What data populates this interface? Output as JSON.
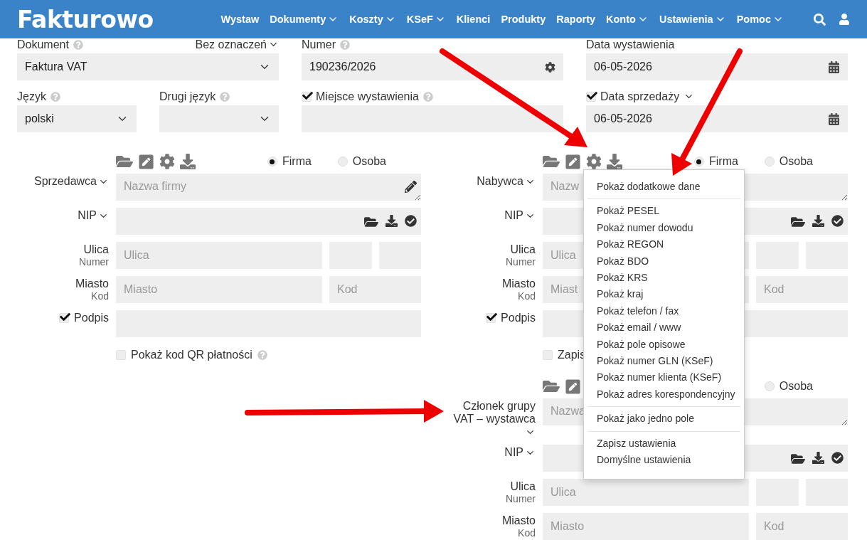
{
  "header": {
    "logo": "Fakturowo",
    "nav": [
      {
        "label": "Wystaw",
        "dropdown": false
      },
      {
        "label": "Dokumenty",
        "dropdown": true
      },
      {
        "label": "Koszty",
        "dropdown": true
      },
      {
        "label": "KSeF",
        "dropdown": true
      },
      {
        "label": "Klienci",
        "dropdown": false
      },
      {
        "label": "Produkty",
        "dropdown": false
      },
      {
        "label": "Raporty",
        "dropdown": false
      },
      {
        "label": "Konto",
        "dropdown": true
      },
      {
        "label": "Ustawienia",
        "dropdown": true
      },
      {
        "label": "Pomoc",
        "dropdown": true
      }
    ]
  },
  "document": {
    "type": {
      "label": "Dokument",
      "help": true,
      "value": "Faktura VAT"
    },
    "marking": "Bez oznaczeń",
    "number": {
      "label": "Numer",
      "help": true,
      "value": "190236/2026"
    },
    "issue_date": {
      "label": "Data wystawienia",
      "value": "06-05-2026"
    },
    "language": {
      "label": "Język",
      "help": true,
      "value": "polski"
    },
    "second_language": {
      "label": "Drugi język",
      "help": true
    },
    "place": {
      "label": "Miejsce wystawienia",
      "help": true,
      "checked": true
    },
    "sale_date": {
      "label": "Data sprzedaży",
      "checked": true,
      "value": "06-05-2026"
    }
  },
  "parties": [
    {
      "label": "Sprzedawca",
      "tools": [
        {
          "kind": "folder"
        },
        {
          "kind": "edit"
        },
        {
          "kind": "gear"
        },
        {
          "kind": "download"
        }
      ],
      "radios": [
        {
          "label": "Firma",
          "selected": true
        },
        {
          "label": "Osoba",
          "selected": false
        }
      ],
      "name_placeholder": "Nazwa firmy",
      "name_pencil": true,
      "nip_label": "NIP",
      "street_label": "Ulica",
      "street_sub": "Numer",
      "street_placeholder": "Ulica",
      "city_label": "Miasto",
      "city_sub": "Kod",
      "city_placeholder": "Miasto",
      "code_placeholder": "Kod",
      "signature": {
        "label": "Podpis",
        "checked": true
      },
      "option": {
        "label": "Pokaż kod QR płatności",
        "checked": false,
        "help": true
      }
    },
    {
      "label": "Nabywca",
      "tools": [
        {
          "kind": "folder"
        },
        {
          "kind": "edit"
        },
        {
          "kind": "gear"
        },
        {
          "kind": "download"
        }
      ],
      "radios": [
        {
          "label": "Firma",
          "selected": true
        },
        {
          "label": "Osoba",
          "selected": false
        }
      ],
      "name_placeholder": "Nazw",
      "nip_label": "NIP",
      "street_label": "Ulica",
      "street_sub": "Numer",
      "street_placeholder": "Ulica",
      "city_label": "Miasto",
      "city_sub": "Kod",
      "city_placeholder": "Miast",
      "code_placeholder": "Kod",
      "signature": {
        "label": "Podpis",
        "checked": true
      },
      "option": {
        "label": "Zapis",
        "checked": false
      }
    },
    {
      "label": "Członek grupy VAT – wystawca",
      "tools": [
        {
          "kind": "folder"
        },
        {
          "kind": "edit"
        }
      ],
      "radios": [
        {
          "label": "Osoba",
          "selected": false
        }
      ],
      "name_placeholder": "Nazwa",
      "nip_label": "NIP",
      "street_label": "Ulica",
      "street_sub": "Numer",
      "street_placeholder": "Ulica",
      "city_label": "Miasto",
      "city_sub": "Kod",
      "city_placeholder": "Miasto",
      "code_placeholder": "Kod"
    }
  ],
  "menu": {
    "groups": [
      [
        "Pokaż dodatkowe dane"
      ],
      [
        "Pokaż PESEL",
        "Pokaż numer dowodu",
        "Pokaż REGON",
        "Pokaż BDO",
        "Pokaż KRS",
        "Pokaż kraj",
        "Pokaż telefon / fax",
        "Pokaż email / www",
        "Pokaż pole opisowe",
        "Pokaż numer GLN (KSeF)",
        "Pokaż numer klienta (KSeF)",
        "Pokaż adres korespondencyjny"
      ],
      [
        "Pokaż jako jedno pole"
      ],
      [
        "Zapisz ustawienia",
        "Domyślne ustawienia"
      ]
    ]
  }
}
